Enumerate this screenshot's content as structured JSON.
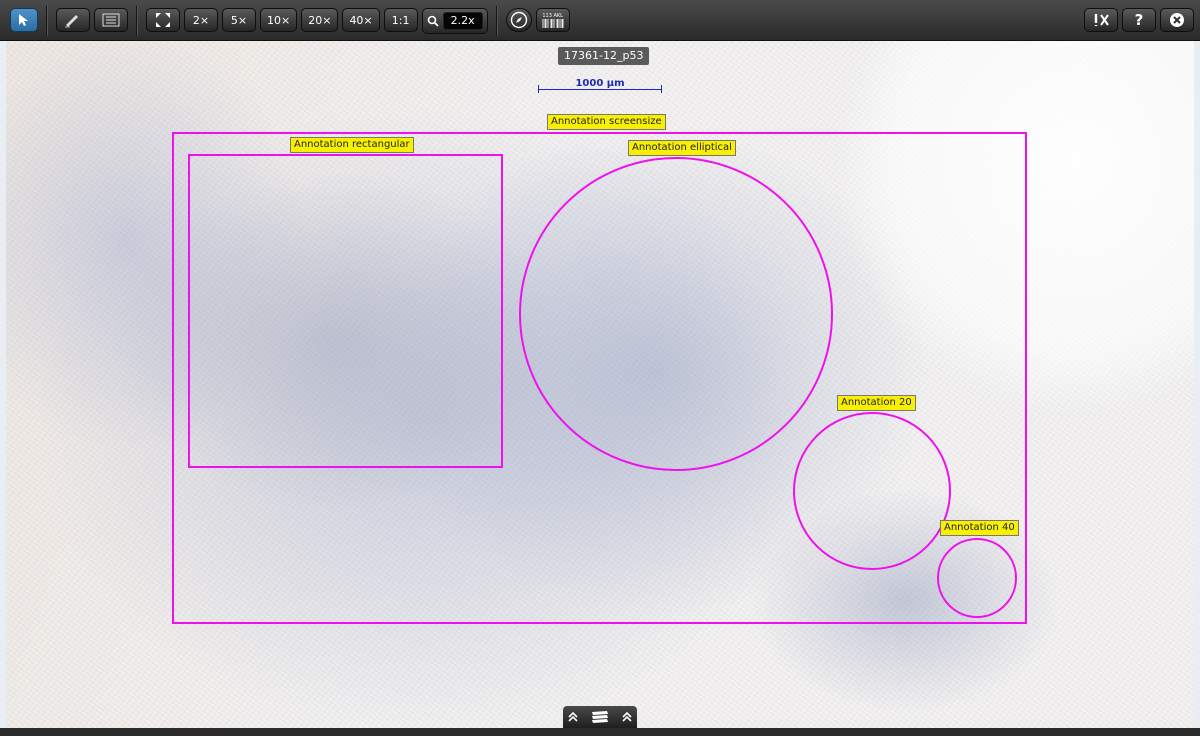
{
  "toolbar": {
    "select_tool": "select",
    "annotate_tool": "annotate",
    "list_tool": "annotation-list",
    "fit": "fit",
    "zoom_presets": [
      "2×",
      "5×",
      "10×",
      "20×",
      "40×",
      "1:1"
    ],
    "zoom_value": "2.2x",
    "navigator": "navigator",
    "barcode_label": "113 AKL",
    "help": "?",
    "tools": "tools",
    "close": "close"
  },
  "slide": {
    "name": "17361-12_p53",
    "scalebar_label": "1000 µm"
  },
  "annotations": [
    {
      "label": "Annotation screensize",
      "shape": "rectangle",
      "color": "#ee11ee"
    },
    {
      "label": "Annotation rectangular",
      "shape": "rectangle",
      "color": "#ee11ee"
    },
    {
      "label": "Annotation elliptical",
      "shape": "ellipse",
      "color": "#ee11ee"
    },
    {
      "label": "Annotation 20",
      "shape": "ellipse",
      "color": "#ee11ee"
    },
    {
      "label": "Annotation 40",
      "shape": "ellipse",
      "color": "#ee11ee"
    }
  ],
  "colors": {
    "annotation": "#ee11ee",
    "label_bg": "#f8f000",
    "scalebar": "#1d2bb5",
    "active_tool": "#3d82bb"
  }
}
